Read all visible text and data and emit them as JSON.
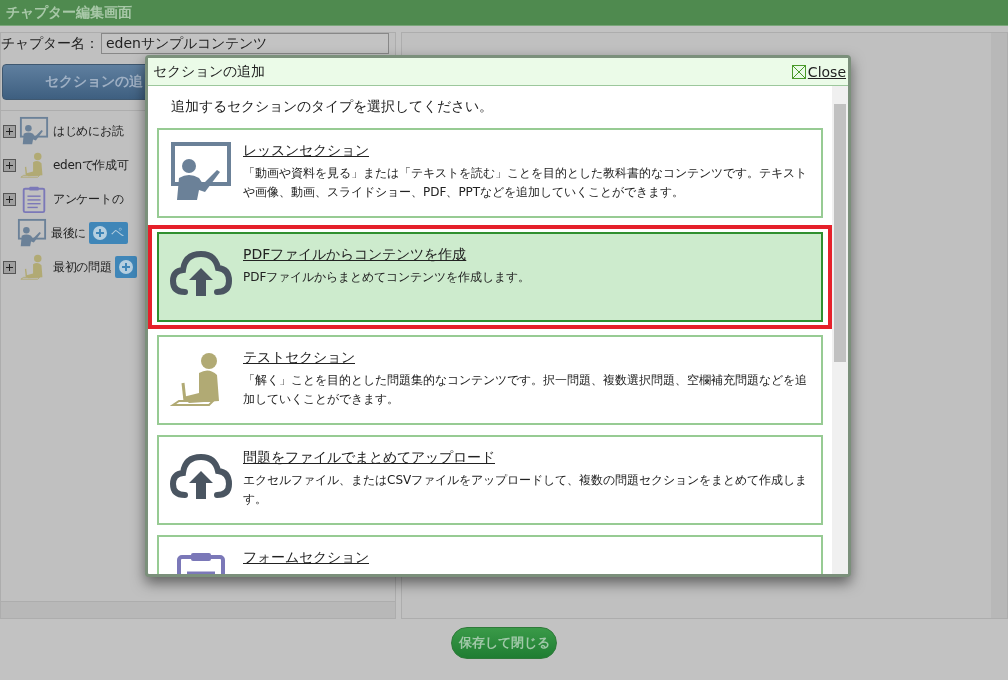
{
  "window": {
    "title": "チャプター編集画面"
  },
  "chapter_name": {
    "label": "チャプター名：",
    "value": "edenサンプルコンテンツ"
  },
  "add_section_button": {
    "label": "セクションの追"
  },
  "tree": [
    {
      "kind": "lesson",
      "label": "はじめにお読",
      "expandable": true
    },
    {
      "kind": "test",
      "label": "edenで作成可",
      "expandable": true
    },
    {
      "kind": "form",
      "label": "アンケートの",
      "expandable": true
    },
    {
      "kind": "lesson",
      "label": "最後に",
      "expandable": false,
      "actions": [
        {
          "kind": "add",
          "label": "ペ"
        }
      ]
    },
    {
      "kind": "test",
      "label": "最初の問題",
      "expandable": true,
      "actions": [
        {
          "kind": "add"
        }
      ]
    }
  ],
  "dialog": {
    "title": "セクションの追加",
    "close": "Close",
    "prompt": "追加するセクションのタイプを選択してください。",
    "options": [
      {
        "kind": "lesson",
        "title": "レッスンセクション",
        "description": "「動画や資料を見る」または「テキストを読む」ことを目的とした教科書的なコンテンツです。テキストや画像、動画、スライドショー、PDF、PPTなどを追加していくことができます。",
        "selected": false
      },
      {
        "kind": "upload",
        "title": "PDFファイルからコンテンツを作成",
        "description": "PDFファイルからまとめてコンテンツを作成します。",
        "selected": true
      },
      {
        "kind": "test",
        "title": "テストセクション",
        "description": "「解く」ことを目的とした問題集的なコンテンツです。択一問題、複数選択問題、空欄補充問題などを追加していくことができます。",
        "selected": false
      },
      {
        "kind": "upload",
        "title": "問題をファイルでまとめてアップロード",
        "description": "エクセルファイル、またはCSVファイルをアップロードして、複数の問題セクションをまとめて作成します。",
        "selected": false
      },
      {
        "kind": "form",
        "title": "フォームセクション",
        "selected": false
      }
    ]
  },
  "save_button": {
    "label": "保存して閉じる"
  }
}
